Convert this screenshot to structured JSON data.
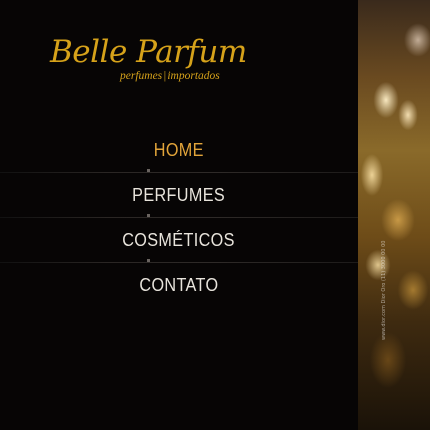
{
  "logo": {
    "title": "Belle Parfum",
    "subtitle_left": "perfumes",
    "subtitle_sep": "|",
    "subtitle_right": "importados"
  },
  "menu": {
    "items": [
      {
        "label": "HOME",
        "active": true
      },
      {
        "label": "PERFUMES",
        "active": false
      },
      {
        "label": "COSMÉTICOS",
        "active": false
      },
      {
        "label": "CONTATO",
        "active": false
      }
    ]
  },
  "photo": {
    "credit": "www.dior.com Dior Oro (11) 3000 00 00"
  },
  "colors": {
    "gold": "#d6a21a",
    "active_menu": "#e3a53a",
    "menu_text": "#e8e4dc",
    "background": "#070505"
  }
}
